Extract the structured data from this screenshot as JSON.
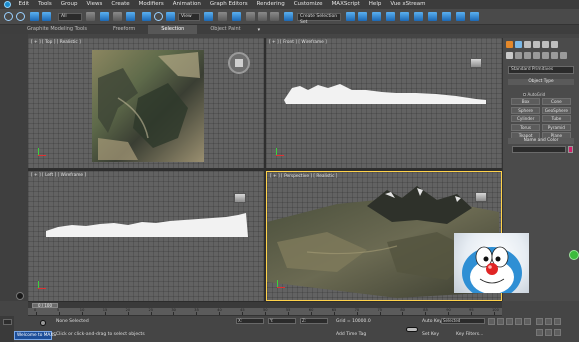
{
  "menu": [
    "Edit",
    "Tools",
    "Group",
    "Views",
    "Create",
    "Modifiers",
    "Animation",
    "Graph Editors",
    "Rendering",
    "Customize",
    "MAXScript",
    "Help",
    "Vue xStream"
  ],
  "toolbar": {
    "selection_filter": "All",
    "reference_coord": "View",
    "named_selection": "Create Selection Set"
  },
  "ribbon": {
    "tabs": [
      {
        "label": "Graphite Modeling Tools",
        "active": false
      },
      {
        "label": "Freeform",
        "active": false
      },
      {
        "label": "Selection",
        "active": true
      },
      {
        "label": "Object Paint",
        "active": false
      }
    ],
    "menu_arrow": "▾"
  },
  "viewports": {
    "top": "[ + ] [ Top ] [ Realistic ]",
    "front": "[ + ] [ Front ] [ Wireframe ]",
    "left": "[ + ] [ Left ] [ Wireframe ]",
    "perspective": "[ + ] [ Perspective ] [ Realistic ]"
  },
  "command_panel": {
    "category": "Standard Primitives",
    "object_type_header": "Object Type",
    "autogrid_label": "AutoGrid",
    "buttons": [
      "Box",
      "Cone",
      "Sphere",
      "GeoSphere",
      "Cylinder",
      "Tube",
      "Torus",
      "Pyramid",
      "Teapot",
      "Plane"
    ],
    "name_color_header": "Name and Color",
    "accent_color": "#d01f6a"
  },
  "timeline": {
    "slider_label": "0 / 100",
    "ruler_ticks": [
      "0",
      "5",
      "10",
      "15",
      "20",
      "25",
      "30",
      "35",
      "40",
      "45",
      "50",
      "55",
      "60",
      "65",
      "70",
      "75",
      "80",
      "85",
      "90",
      "95",
      "100"
    ]
  },
  "status_bar": {
    "welcome": "Welcome to MAXS",
    "selection_info": "None Selected",
    "prompt": "Click or click-and-drag to select objects",
    "x_field": "X:",
    "y_field": "Y:",
    "z_field": "Z:",
    "grid": "Grid = 10000.0",
    "add_time_tag": "Add Time Tag",
    "auto_key": "Auto Key",
    "selected_dropdown": "Selected",
    "set_key": "Set Key",
    "key_filters": "Key Filters..."
  },
  "icons": [
    "app-logo-icon",
    "undo-icon",
    "select-icon",
    "move-icon",
    "rotate-icon",
    "scale-icon",
    "snap-icon",
    "mirror-icon",
    "align-icon",
    "render-icon",
    "viewcube-icon",
    "lock-icon",
    "play-icon",
    "key-icon",
    "zoom-icon",
    "orbit-icon",
    "pan-icon",
    "maximize-icon"
  ]
}
